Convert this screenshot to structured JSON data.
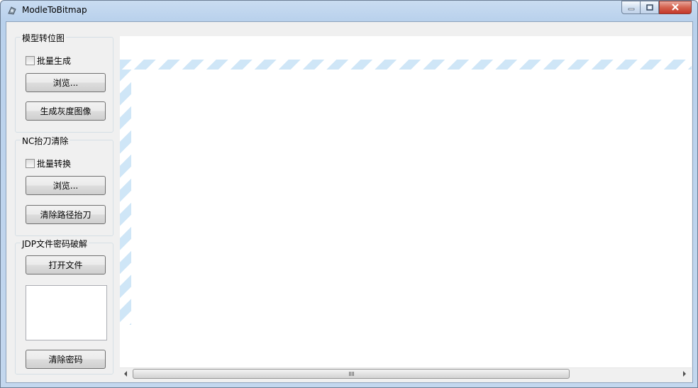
{
  "window": {
    "title": "ModleToBitmap"
  },
  "groups": {
    "model": {
      "title": "模型转位图",
      "checkbox_label": "批量生成",
      "browse_label": "浏览...",
      "generate_label": "生成灰度图像"
    },
    "nc": {
      "title": "NC抬刀清除",
      "checkbox_label": "批量转换",
      "browse_label": "浏览...",
      "clear_label": "清除路径抬刀"
    },
    "jdp": {
      "title": "JDP文件密码破解",
      "open_label": "打开文件",
      "password_value": "",
      "clear_label": "清除密码"
    }
  },
  "icons": {
    "app": "app-icon",
    "minimize": "minimize-icon",
    "maximize": "maximize-icon",
    "close": "close-icon",
    "scroll_left": "chevron-left-icon",
    "scroll_right": "chevron-right-icon",
    "scroll_grip": "grip-icon"
  },
  "colors": {
    "hatch": "#cfe6f7",
    "close_button": "#c4382a"
  }
}
